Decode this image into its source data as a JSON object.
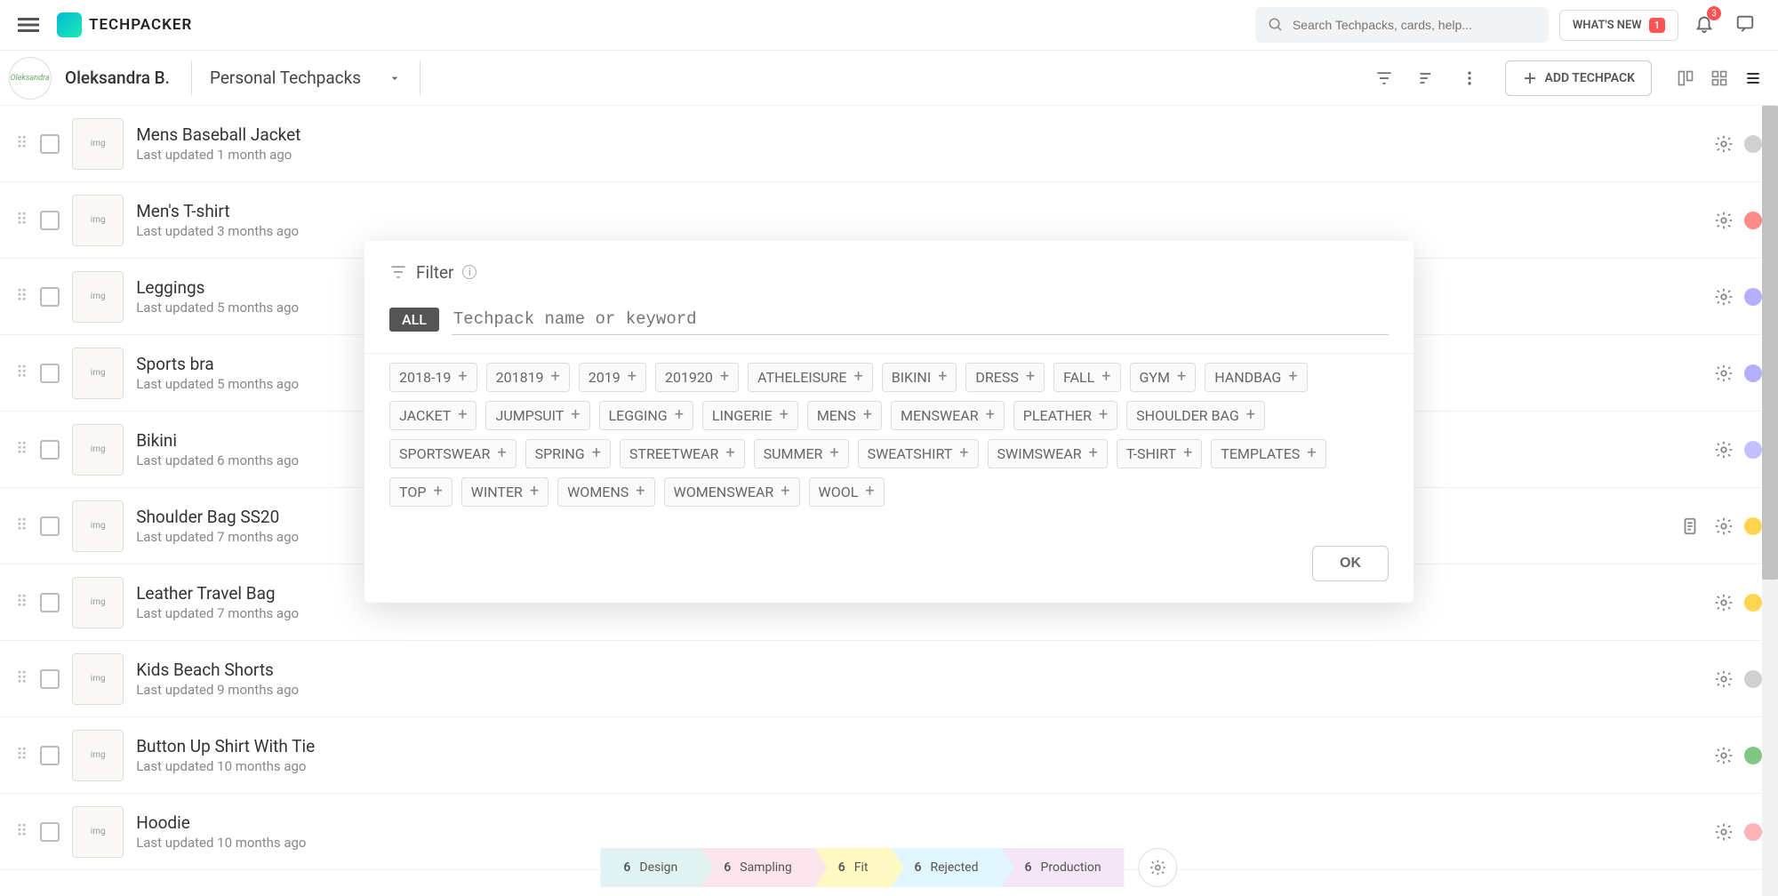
{
  "navbar": {
    "brand": "TECHPACKER",
    "search_placeholder": "Search Techpacks, cards, help...",
    "whats_new": "WHAT'S NEW",
    "whats_new_count": "1",
    "bell_count": "3"
  },
  "toolbar": {
    "avatar_text": "Oleksandra",
    "owner": "Oleksandra B.",
    "workspace": "Personal Techpacks",
    "add_btn": "ADD TECHPACK"
  },
  "techpacks": [
    {
      "title": "Mens Baseball Jacket",
      "sub": "Last updated 1 month ago",
      "dot": "dot-grey",
      "clipboard": false
    },
    {
      "title": "Men's T-shirt",
      "sub": "Last updated 3 months ago",
      "dot": "dot-red",
      "clipboard": false
    },
    {
      "title": "Leggings",
      "sub": "Last updated 5 months ago",
      "dot": "dot-purple",
      "clipboard": false
    },
    {
      "title": "Sports bra",
      "sub": "Last updated 5 months ago",
      "dot": "dot-purple",
      "clipboard": false
    },
    {
      "title": "Bikini",
      "sub": "Last updated 6 months ago",
      "dot": "dot-lightpurple",
      "clipboard": false
    },
    {
      "title": "Shoulder Bag SS20",
      "sub": "Last updated 7 months ago",
      "dot": "dot-yellow",
      "clipboard": true
    },
    {
      "title": "Leather Travel Bag",
      "sub": "Last updated 7 months ago",
      "dot": "dot-yellow",
      "clipboard": false
    },
    {
      "title": "Kids Beach Shorts",
      "sub": "Last updated 9 months ago",
      "dot": "dot-grey",
      "clipboard": false
    },
    {
      "title": "Button Up Shirt With Tie",
      "sub": "Last updated 10 months ago",
      "dot": "dot-green",
      "clipboard": false
    },
    {
      "title": "Hoodie",
      "sub": "Last updated 10 months ago",
      "dot": "dot-pink",
      "clipboard": false
    }
  ],
  "filter": {
    "title": "Filter",
    "all_chip": "ALL",
    "search_placeholder": "Techpack name or keyword",
    "ok": "OK",
    "tags": [
      "2018-19",
      "201819",
      "2019",
      "201920",
      "ATHELEISURE",
      "BIKINI",
      "DRESS",
      "FALL",
      "GYM",
      "HANDBAG",
      "JACKET",
      "JUMPSUIT",
      "LEGGING",
      "LINGERIE",
      "MENS",
      "MENSWEAR",
      "PLEATHER",
      "SHOULDER BAG",
      "SPORTSWEAR",
      "SPRING",
      "STREETWEAR",
      "SUMMER",
      "SWEATSHIRT",
      "SWIMSWEAR",
      "T-SHIRT",
      "TEMPLATES",
      "TOP",
      "WINTER",
      "WOMENS",
      "WOMENSWEAR",
      "WOOL"
    ]
  },
  "status_bar": [
    {
      "count": "6",
      "label": "Design"
    },
    {
      "count": "6",
      "label": "Sampling"
    },
    {
      "count": "6",
      "label": "Fit"
    },
    {
      "count": "6",
      "label": "Rejected"
    },
    {
      "count": "6",
      "label": "Production"
    }
  ]
}
